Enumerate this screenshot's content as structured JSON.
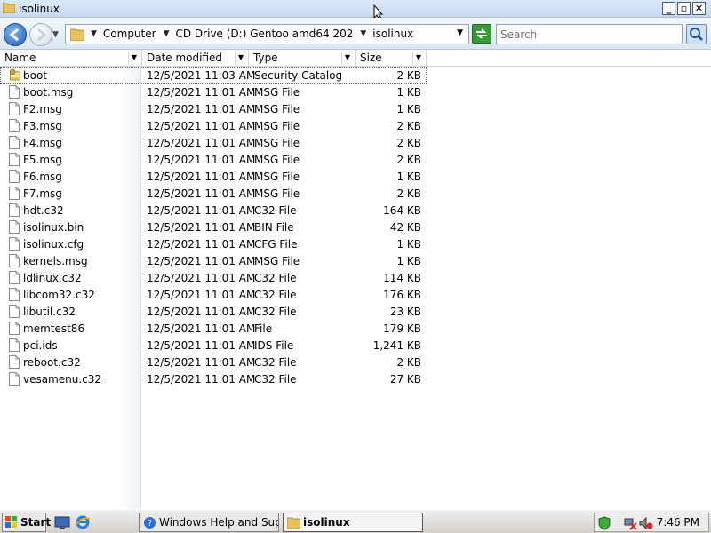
{
  "window": {
    "title": "isolinux"
  },
  "address": {
    "crumbs": [
      "Computer",
      "CD Drive (D:) Gentoo amd64 202",
      "isolinux"
    ]
  },
  "search": {
    "placeholder": "Search"
  },
  "columns": {
    "name": "Name",
    "date": "Date modified",
    "type": "Type",
    "size": "Size"
  },
  "files": [
    {
      "name": "boot",
      "date": "12/5/2021 11:03 AM",
      "type": "Security Catalog",
      "size": "2 KB",
      "icon": "security-catalog-icon"
    },
    {
      "name": "boot.msg",
      "date": "12/5/2021 11:01 AM",
      "type": "MSG File",
      "size": "1 KB",
      "icon": "file-icon"
    },
    {
      "name": "F2.msg",
      "date": "12/5/2021 11:01 AM",
      "type": "MSG File",
      "size": "1 KB",
      "icon": "file-icon"
    },
    {
      "name": "F3.msg",
      "date": "12/5/2021 11:01 AM",
      "type": "MSG File",
      "size": "2 KB",
      "icon": "file-icon"
    },
    {
      "name": "F4.msg",
      "date": "12/5/2021 11:01 AM",
      "type": "MSG File",
      "size": "2 KB",
      "icon": "file-icon"
    },
    {
      "name": "F5.msg",
      "date": "12/5/2021 11:01 AM",
      "type": "MSG File",
      "size": "2 KB",
      "icon": "file-icon"
    },
    {
      "name": "F6.msg",
      "date": "12/5/2021 11:01 AM",
      "type": "MSG File",
      "size": "1 KB",
      "icon": "file-icon"
    },
    {
      "name": "F7.msg",
      "date": "12/5/2021 11:01 AM",
      "type": "MSG File",
      "size": "2 KB",
      "icon": "file-icon"
    },
    {
      "name": "hdt.c32",
      "date": "12/5/2021 11:01 AM",
      "type": "C32 File",
      "size": "164 KB",
      "icon": "file-icon"
    },
    {
      "name": "isolinux.bin",
      "date": "12/5/2021 11:01 AM",
      "type": "BIN File",
      "size": "42 KB",
      "icon": "file-icon"
    },
    {
      "name": "isolinux.cfg",
      "date": "12/5/2021 11:01 AM",
      "type": "CFG File",
      "size": "1 KB",
      "icon": "file-icon"
    },
    {
      "name": "kernels.msg",
      "date": "12/5/2021 11:01 AM",
      "type": "MSG File",
      "size": "1 KB",
      "icon": "file-icon"
    },
    {
      "name": "ldlinux.c32",
      "date": "12/5/2021 11:01 AM",
      "type": "C32 File",
      "size": "114 KB",
      "icon": "file-icon"
    },
    {
      "name": "libcom32.c32",
      "date": "12/5/2021 11:01 AM",
      "type": "C32 File",
      "size": "176 KB",
      "icon": "file-icon"
    },
    {
      "name": "libutil.c32",
      "date": "12/5/2021 11:01 AM",
      "type": "C32 File",
      "size": "23 KB",
      "icon": "file-icon"
    },
    {
      "name": "memtest86",
      "date": "12/5/2021 11:01 AM",
      "type": "File",
      "size": "179 KB",
      "icon": "file-icon"
    },
    {
      "name": "pci.ids",
      "date": "12/5/2021 11:01 AM",
      "type": "IDS File",
      "size": "1,241 KB",
      "icon": "file-icon"
    },
    {
      "name": "reboot.c32",
      "date": "12/5/2021 11:01 AM",
      "type": "C32 File",
      "size": "2 KB",
      "icon": "file-icon"
    },
    {
      "name": "vesamenu.c32",
      "date": "12/5/2021 11:01 AM",
      "type": "C32 File",
      "size": "27 KB",
      "icon": "file-icon"
    }
  ],
  "taskbar": {
    "start_label": "Start",
    "tasks": [
      {
        "label": "Windows Help and Sup...",
        "icon": "help-icon"
      },
      {
        "label": "isolinux",
        "icon": "folder-icon"
      }
    ],
    "clock": "7:46 PM"
  },
  "colors": {
    "accent": "#2264b8",
    "titlebar": "#c4d8ef",
    "refresh": "#3a9a38"
  }
}
